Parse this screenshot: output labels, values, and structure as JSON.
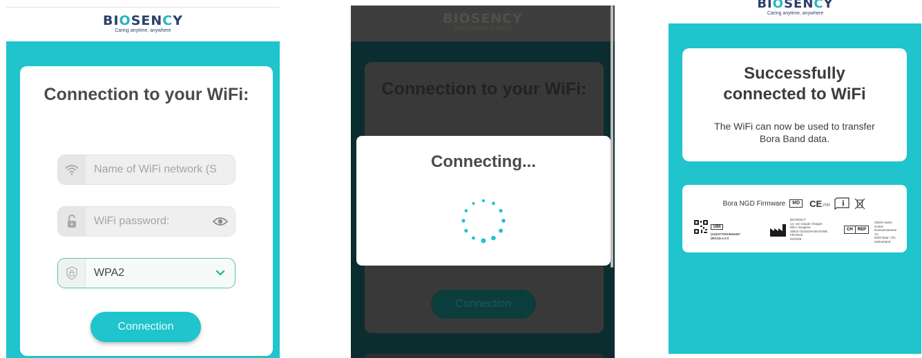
{
  "brand": {
    "logo": "BIOSENCY",
    "tagline": "Caring anytime, anywhere"
  },
  "screen1": {
    "title": "Connection to your WiFi:",
    "ssid_placeholder": "Name of WiFi network (S",
    "password_placeholder": "WiFi password:",
    "security_value": "WPA2",
    "connect_button": "Connection",
    "accent_color": "#1fc4cc"
  },
  "screen2": {
    "bg_title": "Connection to your WiFi:",
    "bg_button": "Connection",
    "modal_title": "Connecting..."
  },
  "screen3": {
    "success_title": "Successfully connected to WiFi",
    "success_body": "The WiFi can now be used to transfer Bora Band data.",
    "firmware_label": "Bora NGD Firmware",
    "md_label": "MD",
    "ce_label": "CE",
    "ce_number": "2797",
    "udi_label": "UDI",
    "udi_line1": "(01)03770024064067",
    "udi_line2": "(8012)v.1.0.0",
    "manufacturer": [
      "BIOSENCY",
      "13, rue Claude Chappe",
      "Bât A Oxygène",
      "35510 CESSON-SEVIGNE",
      "FRANCE",
      "2024/09"
    ],
    "ch_label": "CH",
    "rep_label": "REP",
    "rep_address": [
      "Obelis Swiss GmbH",
      "Ruessenstrasse 12,",
      "6340 Baar / ZG,",
      "Switzerland"
    ]
  }
}
